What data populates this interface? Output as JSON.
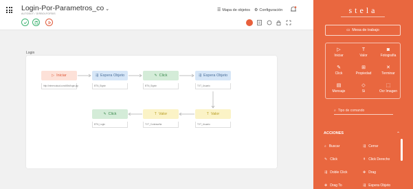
{
  "header": {
    "title": "Login-Por-Parametros_co",
    "subtitle": "AUTOBOT / DIRBOLFOFBIS",
    "links": {
      "mapa": "Mapa de objetos",
      "config": "Configuración"
    }
  },
  "canvas": {
    "label": "Login",
    "nodes": [
      {
        "label": "Iniciar",
        "sub": "http://elmeroutual.com/#8xt/login.jsp",
        "kind": "start"
      },
      {
        "label": "Espera Objeto",
        "sub": "BTN_Signin",
        "kind": "wait"
      },
      {
        "label": "Click",
        "sub": "BTN_Signin",
        "kind": "click"
      },
      {
        "label": "Espera Objeto",
        "sub": "TXT_Usuario",
        "kind": "wait"
      },
      {
        "label": "Valor",
        "sub": "TXT_Usuario",
        "kind": "value"
      },
      {
        "label": "Valor",
        "sub": "TXT_Contraseña",
        "kind": "value"
      },
      {
        "label": "Click",
        "sub": "BTN_Login",
        "kind": "click"
      }
    ]
  },
  "panel": {
    "logo": "stela",
    "mesa_label": "Mesa de trabajo",
    "tools": [
      {
        "label": "Iniciar",
        "icon": "play-icon"
      },
      {
        "label": "Valor",
        "icon": "text-icon"
      },
      {
        "label": "Fotografía",
        "icon": "camera-icon"
      },
      {
        "label": "Click",
        "icon": "click-icon"
      },
      {
        "label": "Propiedad",
        "icon": "property-icon"
      },
      {
        "label": "Terminar",
        "icon": "close-icon"
      },
      {
        "label": "Mensaje",
        "icon": "message-icon"
      },
      {
        "label": "Si",
        "icon": "diamond-icon"
      },
      {
        "label": "Ocr Imagen",
        "icon": "ocr-icon"
      }
    ],
    "search_placeholder": "Tipo de comando",
    "acciones_title": "ACCIONES",
    "acciones": [
      {
        "label": "Buscar",
        "icon": "search-icon"
      },
      {
        "label": "Cerrar",
        "icon": "close-window-icon"
      },
      {
        "label": "Click",
        "icon": "click-icon"
      },
      {
        "label": "Click Derecho",
        "icon": "right-click-icon"
      },
      {
        "label": "Doble Click",
        "icon": "double-click-icon"
      },
      {
        "label": "Drag",
        "icon": "drag-icon"
      },
      {
        "label": "Drag To",
        "icon": "drag-to-icon"
      },
      {
        "label": "Espera Objeto",
        "icon": "wait-object-icon"
      }
    ]
  },
  "colors": {
    "accent": "#e9673f",
    "start": "#fde1d8",
    "wait": "#d6e6f7",
    "click": "#d4ecd8",
    "value": "#fbf3c6"
  }
}
